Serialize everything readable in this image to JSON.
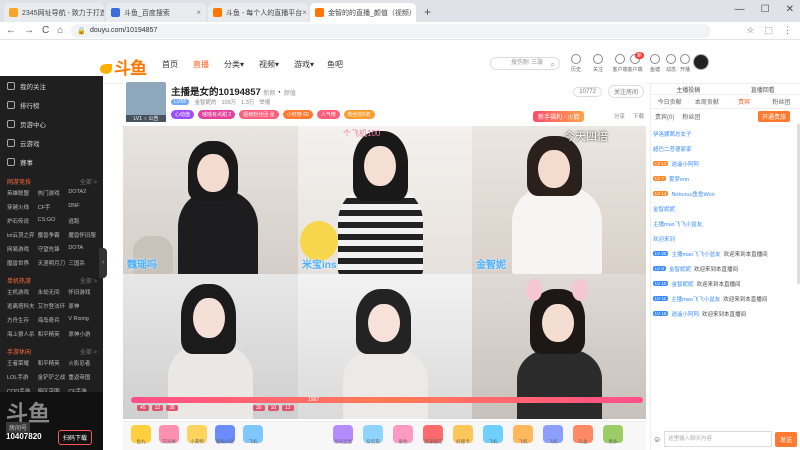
{
  "browser": {
    "tabs": [
      {
        "label": "2345网址导航 - 致力于打造百年",
        "color": "#f5a623"
      },
      {
        "label": "斗鱼_百度搜索",
        "color": "#3b6be0"
      },
      {
        "label": "斗鱼 - 每个人的直播平台",
        "color": "#ff7700"
      },
      {
        "label": "金智的的直播_颜值（视频）",
        "color": "#ff7700",
        "active": true
      }
    ],
    "new_tab": "+",
    "window_controls": [
      "—",
      "☐",
      "✕"
    ],
    "url": "douyu.com/10194857",
    "nav_buttons": [
      "←",
      "→",
      "C",
      "⌂"
    ],
    "right_icons": [
      "☆",
      "⬚",
      "⋮"
    ]
  },
  "site": {
    "logo": "斗鱼",
    "nav": [
      "首页",
      "直播",
      "分类▾",
      "视频▾",
      "游戏▾",
      "鱼吧"
    ],
    "search_placeholder": "搜伤耐·三璇",
    "top_icons": [
      {
        "label": "历史",
        "badge": ""
      },
      {
        "label": "关注"
      },
      {
        "label": "客户端"
      },
      {
        "label": "客户端",
        "badge": "新"
      },
      {
        "label": "鱼塘"
      },
      {
        "label": "动态"
      },
      {
        "label": "开播"
      }
    ]
  },
  "sidebar": {
    "items": [
      "我的关注",
      "排行榜",
      "页游中心",
      "云游戏",
      "赛事"
    ],
    "sections": [
      {
        "title": "网游竞技",
        "more": "全部 >",
        "grid": [
          "英雄联盟",
          "热门游戏",
          "DOTA2",
          "穿越火线",
          "CF手",
          "DNF",
          "炉石传说",
          "CS:GO",
          "逃跑",
          "lol云顶之弈",
          "魔兽争霸",
          "魔兽怀旧服",
          "网易游戏",
          "守望先锋",
          "DOTA",
          "魔兽世界",
          "天涯明月刀",
          "三国杀"
        ]
      },
      {
        "title": "单机热游",
        "more": "全部 >",
        "grid": [
          "主机游戏",
          "永劫无间",
          "怀旧游戏",
          "逃离塔科夫",
          "艾尔登法环",
          "原神",
          "方舟生存",
          "海岛奇兵",
          "V Rising",
          "海上狼人杀",
          "和平精英",
          "原神小游"
        ]
      },
      {
        "title": "手游休闲",
        "more": "全部 >",
        "grid": [
          "王者荣耀",
          "和平精英",
          "火影忍者",
          "LOL手游",
          "金铲铲之战",
          "重返帝国",
          "COD手游",
          "暗区突围",
          "CF手游",
          "阴阳师",
          "第五人格",
          "天刀手游"
        ]
      }
    ],
    "footer": {
      "brand": "斗鱼",
      "room_label": "房间号",
      "room_no": "10407820",
      "button": "扫码下载"
    }
  },
  "room": {
    "avatar_label": "LV1  ♀ 公告",
    "title": "主播是女的10194857",
    "tags_top": [
      "新颜",
      "颜值"
    ],
    "meta": [
      "LV55",
      "金智妮的",
      "109万",
      "1.3万",
      "举报"
    ],
    "tags": [
      {
        "label": "心动值",
        "color": "#9c4dff"
      },
      {
        "label": "瑶瑶有点甜 2",
        "color": "#e43f9a"
      },
      {
        "label": "超级粉丝团·星",
        "color": "#ff5d7a"
      },
      {
        "label": "小时榜 60",
        "color": "#ff7a30"
      },
      {
        "label": "人气榜",
        "color": "#ff5d7a"
      },
      {
        "label": "粉丝前5名",
        "color": "#ff9e2c"
      }
    ],
    "banner": "新手福利 · 火箭",
    "count": "10772",
    "watch_btn": "关注房间",
    "tools": [
      "分享",
      "下载"
    ]
  },
  "video": {
    "labels": [
      "魏瑶吗",
      "米宝ins",
      "金智妮"
    ],
    "overlays": [
      "个飞机100",
      "今天四倍"
    ],
    "progress_stats": [
      "45",
      "12",
      "38",
      "30",
      "10",
      "12"
    ],
    "pk_text": "1987"
  },
  "gifts": [
    "鱼丸",
    "荧光棒",
    "小黄鸭",
    "超级火箭",
    "飞机",
    "月光宝盒",
    "穿云箭",
    "紫色",
    "浪漫烟花",
    "好感卡",
    "飞机",
    "飞机",
    "飞机",
    "礼盒",
    "更多"
  ],
  "chat_panel": {
    "top": [
      "主播投稿",
      "直播回看"
    ],
    "tabs": [
      "今日贡献",
      "本周贡献",
      "贵宾",
      "粉丝团"
    ],
    "sub": [
      "贵宾(0)",
      "粉丝团"
    ],
    "open_btn": "开通贵族",
    "messages": [
      {
        "user": "伊洛娜茜总女子",
        "text": "",
        "chip": "",
        "chip_color": ""
      },
      {
        "user": "超巴二苍德家家",
        "text": "",
        "chip": "",
        "chip_color": ""
      },
      {
        "user": "逍遥小阿阿",
        "text": "",
        "chip": "LV 13",
        "chip_color": "#ff8a2e"
      },
      {
        "user": "雾梦enn",
        "text": "",
        "chip": "LV 7",
        "chip_color": "#ff8a2e"
      },
      {
        "user": "Noburuu鱼鱼Won",
        "text": "",
        "chip": "LV 14",
        "chip_color": "#ff8a2e"
      },
      {
        "user": "金智妮妮",
        "text": "",
        "chip": "",
        "chip_color": ""
      },
      {
        "user": "主播mao飞飞小盆友",
        "text": "",
        "chip": "",
        "chip_color": ""
      },
      {
        "user": "欢迎来到",
        "text": "",
        "chip": "",
        "chip_color": ""
      },
      {
        "user": "主播mao飞飞小盆友",
        "text": "欢迎来到本直播间",
        "chip": "LV 20",
        "chip_color": "#3b8cff"
      },
      {
        "user": "金智妮妮",
        "text": "欢迎来到本直播间",
        "chip": "LV 8",
        "chip_color": "#3b8cff"
      },
      {
        "user": "金智妮妮",
        "text": "欢迎来到本直播间",
        "chip": "LV 10",
        "chip_color": "#3b8cff"
      },
      {
        "user": "主播mao飞飞小盆友",
        "text": "欢迎来到本直播间",
        "chip": "LV 11",
        "chip_color": "#3b8cff"
      },
      {
        "user": "逍遥小阿阿",
        "text": "欢迎来到本直播间",
        "chip": "LV 16",
        "chip_color": "#3b8cff"
      }
    ],
    "input_placeholder": "这里输入聊天内容",
    "send": "发送"
  }
}
